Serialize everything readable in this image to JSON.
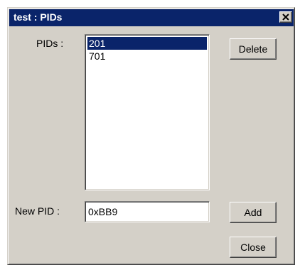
{
  "window": {
    "title": "test : PIDs"
  },
  "pids": {
    "label": "PIDs :",
    "items": [
      {
        "value": "201",
        "selected": true
      },
      {
        "value": "701",
        "selected": false
      }
    ]
  },
  "new_pid": {
    "label": "New PID :",
    "value": "0xBB9"
  },
  "buttons": {
    "delete": "Delete",
    "add": "Add",
    "close": "Close"
  },
  "icons": {
    "title_close": "close-icon"
  },
  "colors": {
    "face": "#d4d0c8",
    "titlebar": "#0a246a",
    "selection": "#0a246a"
  }
}
